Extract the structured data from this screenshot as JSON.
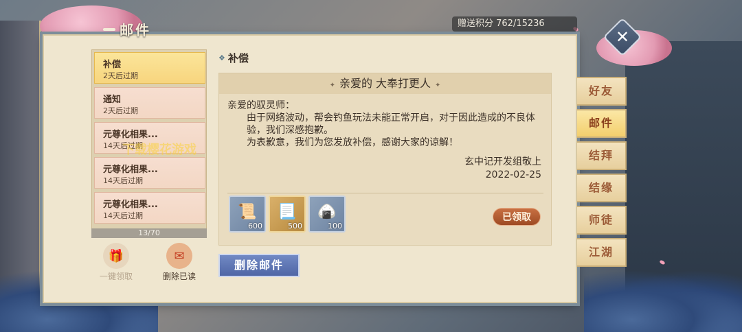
{
  "window": {
    "title": "邮件",
    "points_label": "赠送积分 762/15236"
  },
  "mail_list": {
    "items": [
      {
        "name": "补偿",
        "expire": "2天后过期",
        "active": true
      },
      {
        "name": "通知",
        "expire": "2天后过期",
        "active": false
      },
      {
        "name": "元尊化相果...",
        "expire": "14天后过期",
        "active": false
      },
      {
        "name": "元尊化相果...",
        "expire": "14天后过期",
        "active": false
      },
      {
        "name": "元尊化相果...",
        "expire": "14天后过期",
        "active": false
      }
    ],
    "pager": "13/70",
    "claim_all_label": "一键领取",
    "delete_read_label": "删除已读"
  },
  "mail_detail": {
    "header": "补偿",
    "title": "亲爱的 大奉打更人",
    "greeting": "亲爱的驭灵师：",
    "paragraph1": "由于网络波动，帮会钓鱼玩法未能正常开启，对于因此造成的不良体验，我们深感抱歉。",
    "paragraph2": "为表歉意，我们为您发放补偿，感谢大家的谅解！",
    "signature": "玄中记开发组敬上",
    "date": "2022-02-25",
    "rewards": [
      {
        "icon": "scroll-blue-icon",
        "count": "600"
      },
      {
        "icon": "scroll-gold-icon",
        "count": "500"
      },
      {
        "icon": "zongzi-icon",
        "count": "100"
      }
    ],
    "claimed_label": "已领取",
    "delete_label": "删除邮件"
  },
  "tabs": [
    {
      "label": "好友",
      "active": false
    },
    {
      "label": "邮件",
      "active": true
    },
    {
      "label": "结拜",
      "active": false
    },
    {
      "label": "结缘",
      "active": false
    },
    {
      "label": "师徒",
      "active": false
    },
    {
      "label": "江湖",
      "active": false
    }
  ],
  "watermark": "下载樱花游戏",
  "colors": {
    "accent": "#f7d57e",
    "delete_button": "#5c73b3",
    "claimed_badge": "#b35b30"
  }
}
